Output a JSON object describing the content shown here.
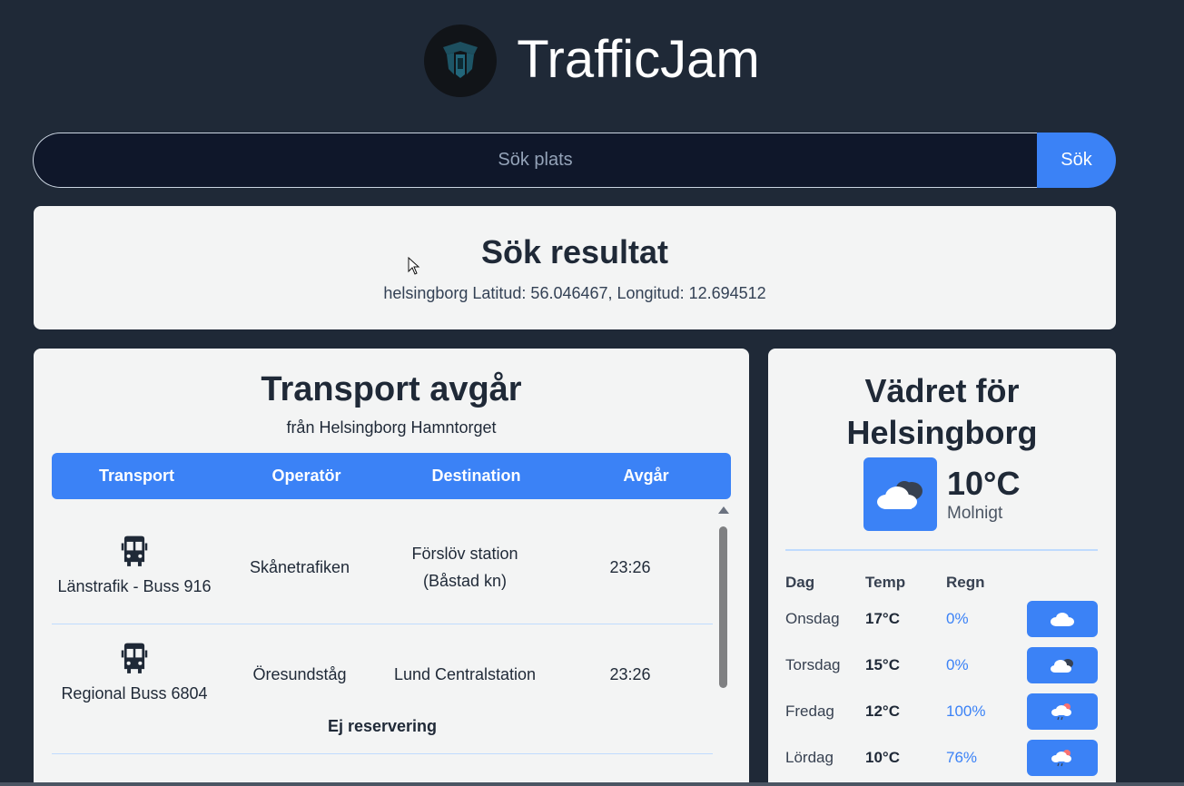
{
  "app": {
    "title": "TrafficJam"
  },
  "search": {
    "placeholder": "Sök plats",
    "button_label": "Sök"
  },
  "result": {
    "title": "Sök resultat",
    "coords_text": "helsingborg Latitud: 56.046467, Longitud: 12.694512"
  },
  "transport": {
    "title": "Transport avgår",
    "subtitle": "från Helsingborg Hamntorget",
    "columns": [
      "Transport",
      "Operatör",
      "Destination",
      "Avgår"
    ],
    "rows": [
      {
        "transport": "Länstrafik - Buss 916",
        "operator": "Skånetrafiken",
        "destination": "Förslöv station (Båstad kn)",
        "departure": "23:26",
        "icon": "bus-icon"
      },
      {
        "transport": "Regional Buss 6804",
        "operator": "Öresundståg",
        "destination": "Lund Centralstation",
        "departure": "23:26",
        "icon": "bus-icon"
      }
    ],
    "note": "Ej reservering"
  },
  "weather": {
    "title": "Vädret för Helsingborg",
    "current_temp": "10°C",
    "current_desc": "Molnigt",
    "current_icon": "cloud-icon",
    "columns": [
      "Dag",
      "Temp",
      "Regn"
    ],
    "forecast": [
      {
        "day": "Onsdag",
        "temp": "17°C",
        "rain": "0%",
        "icon": "cloud-icon"
      },
      {
        "day": "Torsdag",
        "temp": "15°C",
        "rain": "0%",
        "icon": "cloudy-icon"
      },
      {
        "day": "Fredag",
        "temp": "12°C",
        "rain": "100%",
        "icon": "rain-icon"
      },
      {
        "day": "Lördag",
        "temp": "10°C",
        "rain": "76%",
        "icon": "rain-icon"
      }
    ]
  },
  "colors": {
    "background": "#1f2937",
    "accent": "#3b82f6",
    "card": "#f3f4f4"
  }
}
